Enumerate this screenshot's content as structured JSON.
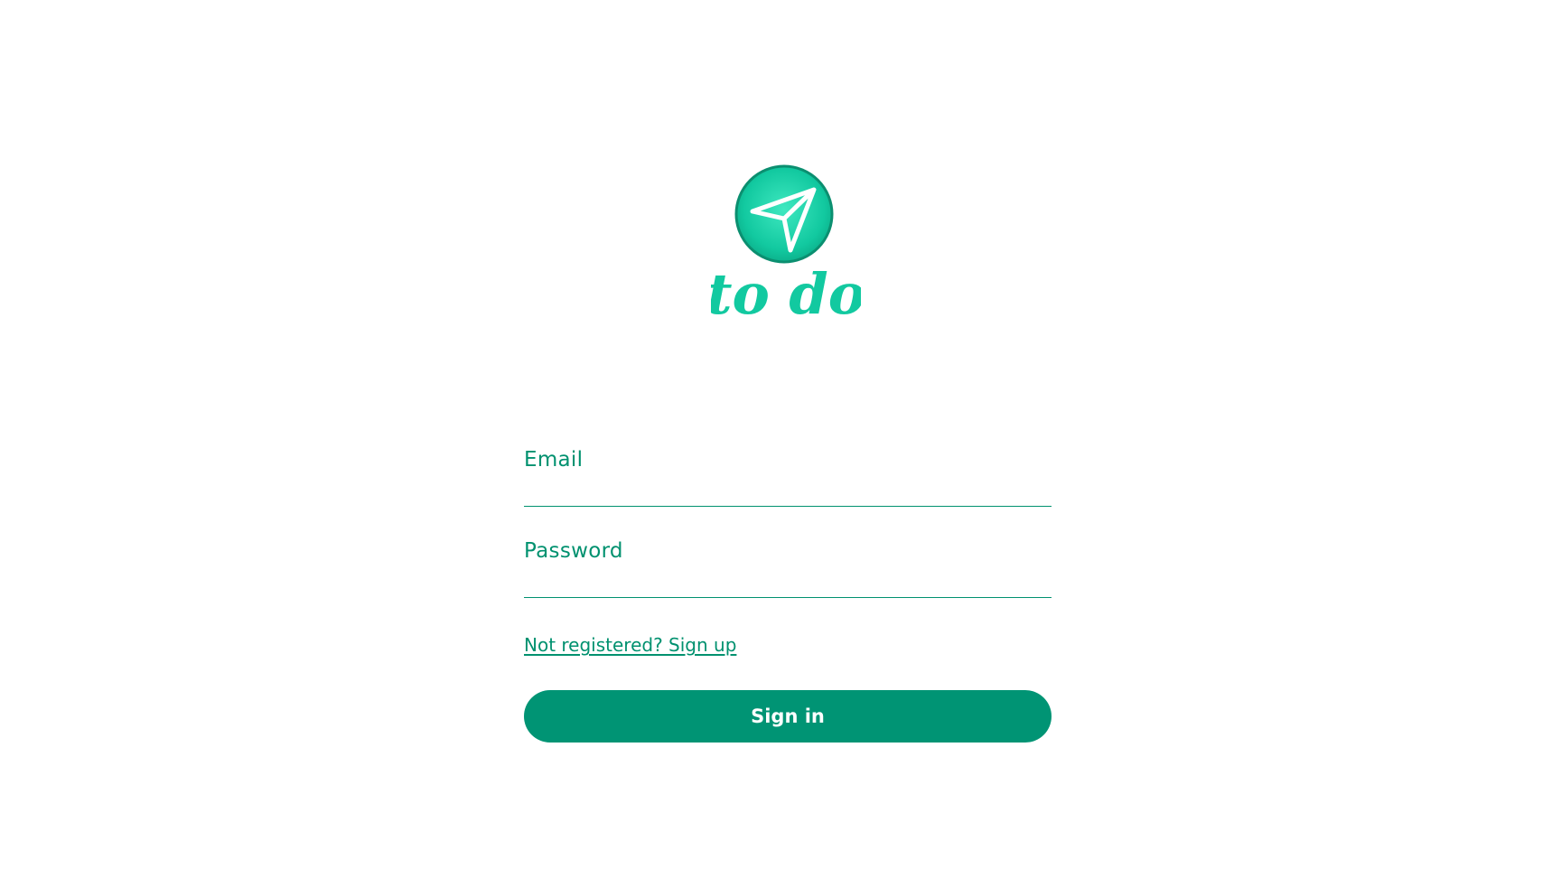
{
  "app": {
    "logo_text": "to do",
    "logo_icon": "paper-plane-icon",
    "brand_color": "#12c9a0",
    "brand_dark": "#00916f"
  },
  "form": {
    "email_label": "Email",
    "email_value": "",
    "password_label": "Password",
    "password_value": "",
    "signup_link": "Not registered? Sign up",
    "signin_button": "Sign in"
  }
}
